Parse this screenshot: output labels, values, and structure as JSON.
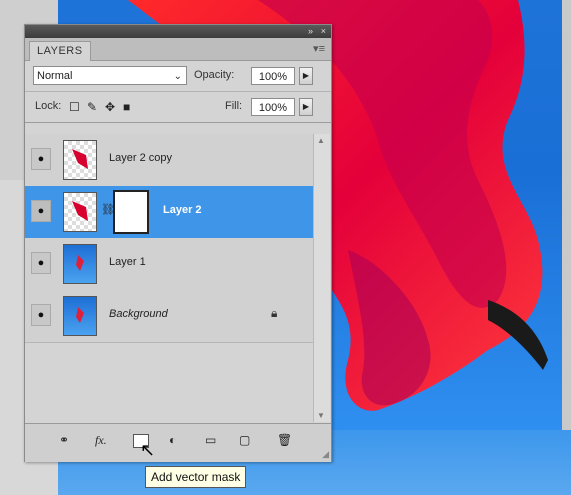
{
  "panel": {
    "title_controls": [
      "»",
      "×"
    ],
    "tab_label": "LAYERS",
    "menu_icon": "panel-menu-icon"
  },
  "blending": {
    "mode_value": "Normal",
    "opacity_label": "Opacity:",
    "opacity_value": "100%",
    "lock_label": "Lock:",
    "fill_label": "Fill:",
    "fill_value": "100%"
  },
  "layers": [
    {
      "name": "Layer 2 copy",
      "thumb": "transparent-with-red-shape",
      "selected": false,
      "has_mask": false,
      "italic": false,
      "locked": false
    },
    {
      "name": "Layer 2",
      "thumb": "transparent-with-red-shape",
      "selected": true,
      "has_mask": true,
      "italic": false,
      "locked": false
    },
    {
      "name": "Layer 1",
      "thumb": "blue-sky-with-figure",
      "selected": false,
      "has_mask": false,
      "italic": false,
      "locked": false
    },
    {
      "name": "Background",
      "thumb": "blue-sky-with-figure",
      "selected": false,
      "has_mask": false,
      "italic": true,
      "locked": true
    }
  ],
  "bottom_icons": [
    "link-layers-icon",
    "fx-icon",
    "add-mask-icon",
    "adjustment-layer-icon",
    "new-group-icon",
    "new-layer-icon",
    "delete-layer-icon"
  ],
  "tooltip": "Add vector mask",
  "colors": {
    "selected_row": "#3f95e8",
    "canvas_sky": "#1e73d8",
    "fabric_red": "#ff1a1a"
  }
}
